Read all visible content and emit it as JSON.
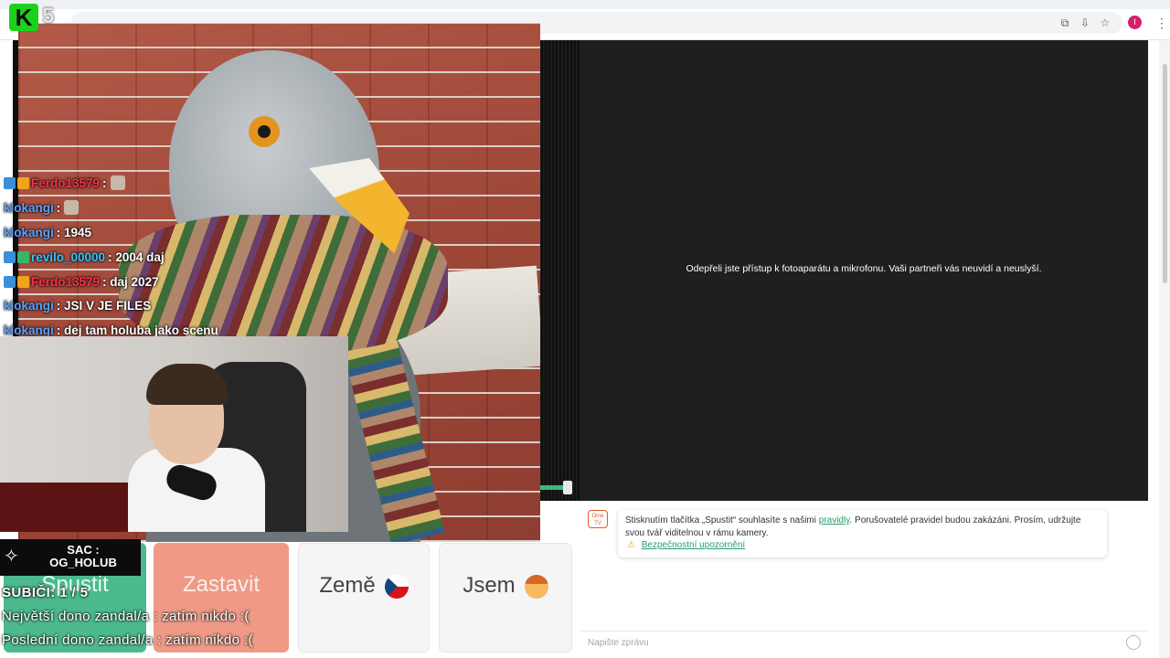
{
  "browser": {
    "toolbar_icons": [
      "translate-icon",
      "install-app-icon",
      "star-icon"
    ],
    "profile_initial": "I",
    "menu_glyph": "⋮"
  },
  "video": {
    "camera_denied_message": "Odepřeli jste přístup k fotoaparátu a mikrofonu. Vaši partneři vás neuvidí a neuslyší."
  },
  "controls": {
    "start_label": "Spustit",
    "stop_label": "Zastavit",
    "country_label": "Země",
    "gender_label": "Jsem"
  },
  "chat": {
    "logo_text": "Ome TV",
    "info_text_before": "Stisknutím tlačítka „Spustit“ souhlasíte s našimi",
    "info_link": "pravidly",
    "info_text_after": ". Porušovatelé pravidel budou zakázáni. Prosím, udržujte svou tvář viditelnou v rámu kamery.",
    "warning_link": "Bezpečnostní upozornění",
    "input_placeholder": "Napište zprávu"
  },
  "stream_overlay": {
    "kick_logo": "K",
    "viewer_count": "5",
    "chat_messages": [
      {
        "user": "Ferdo13579",
        "text": ":",
        "color": "#ff2f4a",
        "badges": [
          "blue",
          "crown"
        ]
      },
      {
        "user": "klokangi",
        "text": ":",
        "color": "#5aa2ff",
        "badges": []
      },
      {
        "user": "klokangi",
        "text": ": 1945",
        "color": "#5aa2ff",
        "badges": []
      },
      {
        "user": "revilo_00000",
        "text": ": 2004 daj",
        "color": "#34c4ff",
        "badges": [
          "blue",
          "green"
        ]
      },
      {
        "user": "Ferdo13579",
        "text": ": daj 2027",
        "color": "#ff2f4a",
        "badges": [
          "blue",
          "crown"
        ]
      },
      {
        "user": "klokangi",
        "text": ": JSI V JE FILES",
        "color": "#5aa2ff",
        "badges": []
      },
      {
        "user": "klokangi",
        "text": ": dej tam holuba jako scenu",
        "color": "#5aa2ff",
        "badges": []
      }
    ],
    "sac_line1": "SAC :",
    "sac_line2": "OG_HOLUB",
    "subs_text": "SUBIČI: 1 / 5",
    "top_dono_text": "Největší dono zandal/a : zatím  nikdo :(",
    "last_dono_text": "Poslední dono zandal/a : zatím nikdo :("
  }
}
